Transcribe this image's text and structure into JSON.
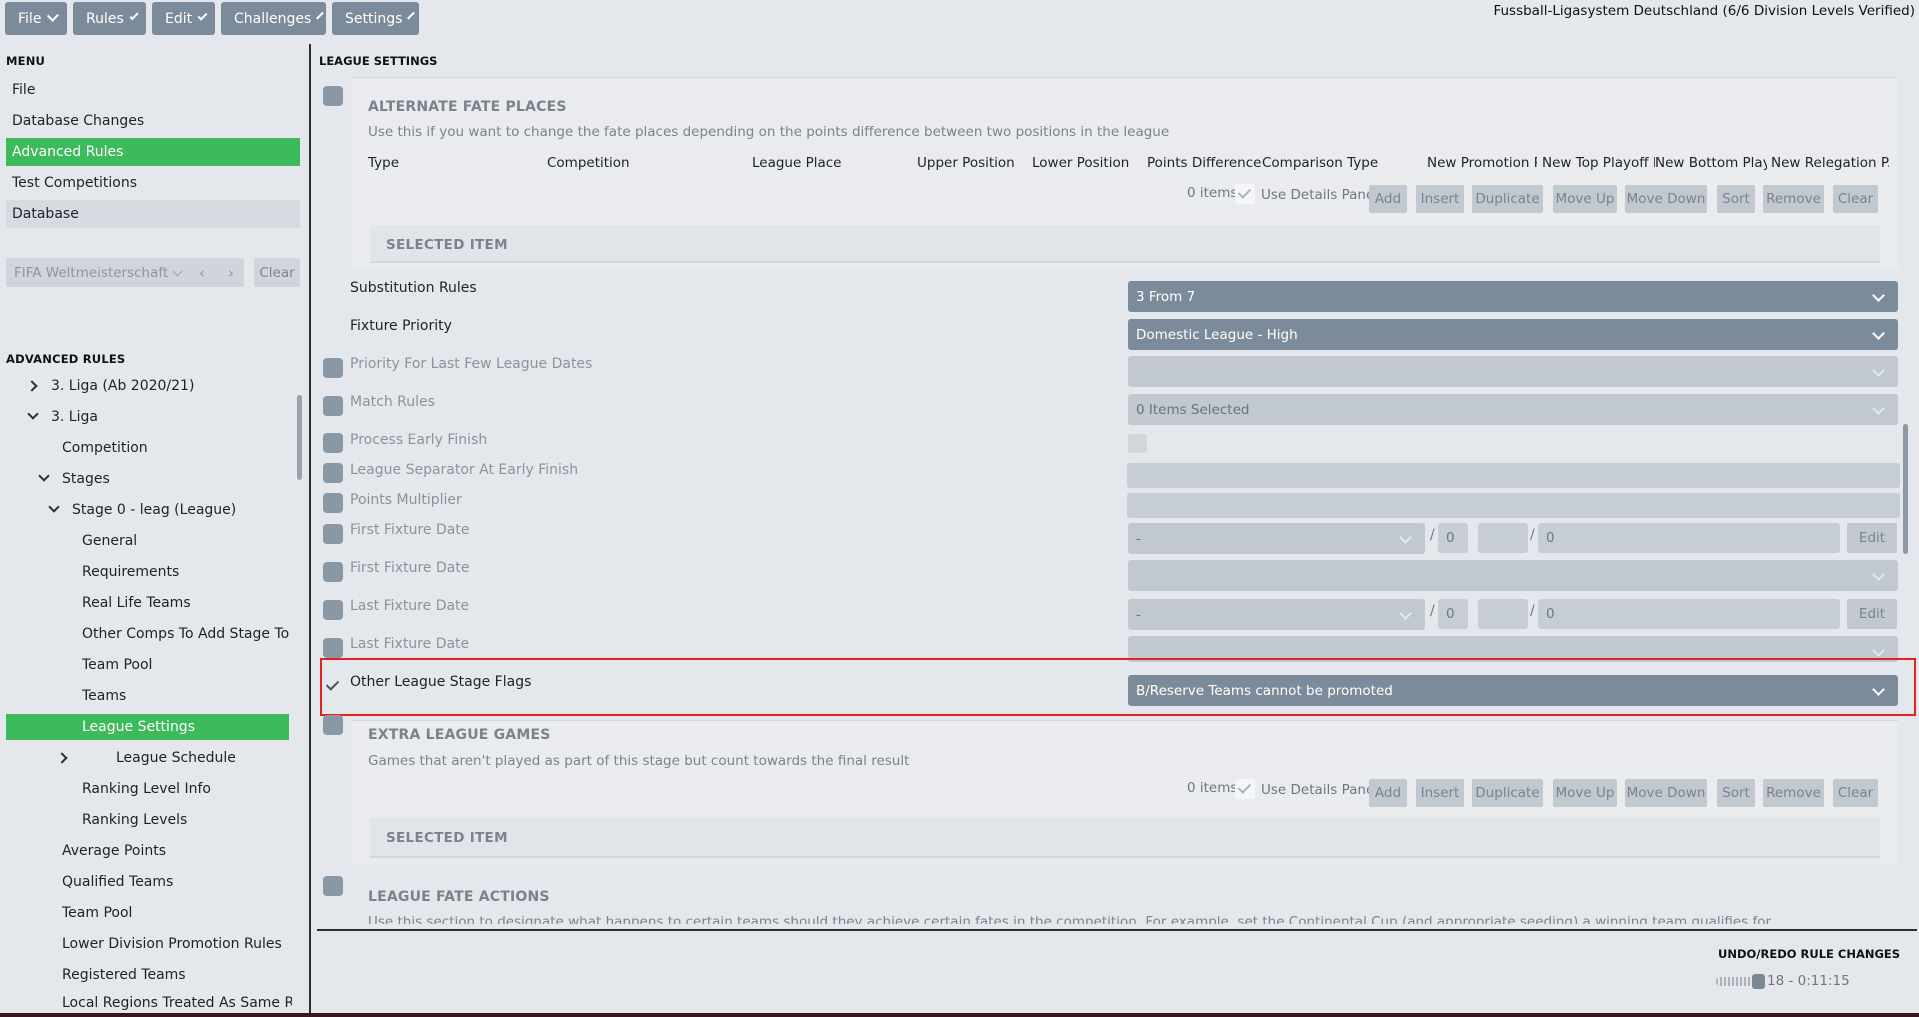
{
  "menubar": {
    "items": [
      "File",
      "Rules",
      "Edit",
      "Challenges",
      "Settings"
    ],
    "league_title": "Fussball-Ligasystem Deutschland (6/6 Division Levels Verified)"
  },
  "left": {
    "menu_head": "MENU",
    "menu": [
      "File",
      "Database Changes",
      "Advanced Rules",
      "Test Competitions",
      "Database"
    ],
    "filter_value": "FIFA Weltmeisterschaft",
    "clear_label": "Clear",
    "adv_head": "ADVANCED RULES",
    "tree": [
      "3. Liga (Ab 2020/21)",
      "3. Liga",
      "Competition",
      "Stages",
      "Stage 0 - leag (League)",
      "General",
      "Requirements",
      "Real Life Teams",
      "Other Comps To Add Stage To",
      "Team Pool",
      "Teams",
      "League Settings",
      "League Schedule",
      "Ranking Level Info",
      "Ranking Levels",
      "Average Points",
      "Qualified Teams",
      "Team Pool",
      "Lower Division Promotion Rules",
      "Registered Teams",
      "Local Regions Treated As Same Region"
    ]
  },
  "main": {
    "head": "LEAGUE SETTINGS",
    "alt_fate": {
      "title": "ALTERNATE FATE PLACES",
      "desc": "Use this if you want to change the fate places depending on the points difference between two positions in the league",
      "columns": [
        "Type",
        "Competition",
        "League Place",
        "Upper Position",
        "Lower Position",
        "Points Difference",
        "Comparison Type",
        "New Promotion Pl...",
        "New Top Playoff P...",
        "New Bottom Play...",
        "New Relegation P..."
      ],
      "items_count": "0 items",
      "use_details": "Use Details Panel",
      "selected_item": "SELECTED ITEM"
    },
    "buttons": [
      "Add",
      "Insert",
      "Duplicate",
      "Move Up",
      "Move Down",
      "Sort",
      "Remove",
      "Clear"
    ],
    "rows": {
      "substitution_rules": {
        "label": "Substitution Rules",
        "value": "3 From 7"
      },
      "fixture_priority": {
        "label": "Fixture Priority",
        "value": "Domestic League - High"
      },
      "priority_last": {
        "label": "Priority For Last Few League Dates"
      },
      "match_rules": {
        "label": "Match Rules",
        "value": "0 Items Selected"
      },
      "process_early": {
        "label": "Process Early Finish"
      },
      "league_separator": {
        "label": "League Separator At Early Finish"
      },
      "points_multiplier": {
        "label": "Points Multiplier"
      },
      "first_fixture_date_1": {
        "label": "First Fixture Date",
        "sel": "-",
        "day": "0",
        "year": "0",
        "edit": "Edit"
      },
      "first_fixture_date_2": {
        "label": "First Fixture Date"
      },
      "last_fixture_date_1": {
        "label": "Last Fixture Date",
        "sel": "-",
        "day": "0",
        "year": "0",
        "edit": "Edit"
      },
      "last_fixture_date_2": {
        "label": "Last Fixture Date"
      },
      "other_flags": {
        "label": "Other League Stage Flags",
        "value": "B/Reserve Teams cannot be promoted"
      }
    },
    "slash": "/",
    "extra_games": {
      "title": "EXTRA LEAGUE GAMES",
      "desc": "Games that aren't played as part of this stage but count towards the final result",
      "items_count": "0 items",
      "use_details": "Use Details Panel",
      "selected_item": "SELECTED ITEM"
    },
    "fate_actions": {
      "title": "LEAGUE FATE ACTIONS",
      "desc": "Use this section to designate what happens to certain teams should they achieve certain fates in the competition. For example, set the Continental Cup (and appropriate seeding) a winning team qualifies for."
    }
  },
  "undo": {
    "head": "UNDO/REDO RULE CHANGES",
    "value": "18 - 0:11:15"
  }
}
